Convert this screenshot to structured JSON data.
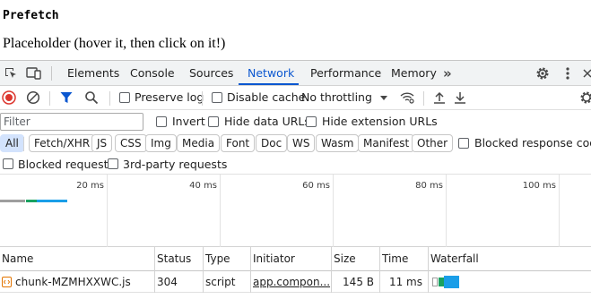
{
  "page": {
    "title": "Prefetch",
    "placeholder": "Placeholder (hover it, then click on it!)"
  },
  "devtools": {
    "tabs": [
      "Elements",
      "Console",
      "Sources",
      "Network",
      "Performance",
      "Memory"
    ],
    "active_tab": "Network",
    "more_tabs_glyph": "»",
    "toolbar": {
      "preserve_log": "Preserve log",
      "disable_cache": "Disable cache",
      "throttling": "No throttling"
    },
    "filter": {
      "placeholder": "Filter",
      "invert": "Invert",
      "hide_data_urls": "Hide data URLs",
      "hide_extension_urls": "Hide extension URLs"
    },
    "types": [
      "All",
      "Fetch/XHR",
      "JS",
      "CSS",
      "Img",
      "Media",
      "Font",
      "Doc",
      "WS",
      "Wasm",
      "Manifest",
      "Other"
    ],
    "active_type": "All",
    "blocked_response_cookies": "Blocked response cookies",
    "blocked_requests": "Blocked requests",
    "third_party_requests": "3rd-party requests",
    "overview_ticks": [
      "20 ms",
      "40 ms",
      "60 ms",
      "80 ms",
      "100 ms"
    ],
    "columns": [
      "Name",
      "Status",
      "Type",
      "Initiator",
      "Size",
      "Time",
      "Waterfall"
    ],
    "rows": [
      {
        "name": "chunk-MZMHXXWC.js",
        "status": "304",
        "type": "script",
        "initiator": "app.compon...",
        "size": "145 B",
        "time": "11 ms"
      }
    ],
    "colors": {
      "accent": "#0b57d0",
      "record": "#dc362e",
      "waterfall_waiting": "#1a73e8",
      "waterfall_download": "#1aa260"
    }
  }
}
